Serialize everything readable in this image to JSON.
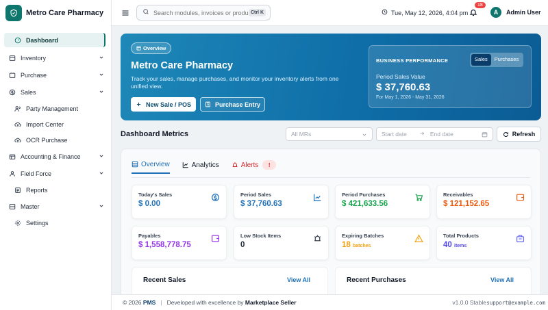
{
  "brand": {
    "name": "Metro Care Pharmacy"
  },
  "sidebar": {
    "items": [
      {
        "label": "Dashboard"
      },
      {
        "label": "Inventory"
      },
      {
        "label": "Purchase"
      },
      {
        "label": "Sales"
      },
      {
        "label": "Party Management"
      },
      {
        "label": "Import Center"
      },
      {
        "label": "OCR Purchase"
      },
      {
        "label": "Accounting & Finance"
      },
      {
        "label": "Field Force"
      },
      {
        "label": "Reports"
      },
      {
        "label": "Master"
      },
      {
        "label": "Settings"
      }
    ]
  },
  "topbar": {
    "search_placeholder": "Search modules, invoices or products...",
    "shortcut": "Ctrl K",
    "datetime": "Tue, May 12, 2026, 4:04 pm",
    "notification_count": "18",
    "avatar_initial": "A",
    "user_name": "Admin User"
  },
  "hero": {
    "chip": "Overview",
    "title": "Metro Care Pharmacy",
    "description": "Track your sales, manage purchases, and monitor your inventory alerts from one unified view.",
    "new_sale": "New Sale / POS",
    "purchase_entry": "Purchase Entry",
    "perf_title": "BUSINESS PERFORMANCE",
    "seg_sales": "Sales",
    "seg_purchases": "Purchases",
    "perf_label": "Period Sales Value",
    "perf_value": "$ 37,760.63",
    "perf_range": "For May 1, 2026 - May 31, 2026"
  },
  "metrics": {
    "title": "Dashboard Metrics",
    "mr_placeholder": "All MRs",
    "start_date": "Start date",
    "end_date": "End date",
    "refresh": "Refresh"
  },
  "tabs": {
    "overview": "Overview",
    "analytics": "Analytics",
    "alerts": "Alerts",
    "alerts_count": "!"
  },
  "stats": [
    {
      "label": "Today's Sales",
      "value": "$ 0.00",
      "color": "#1d6fb8"
    },
    {
      "label": "Period Sales",
      "value": "$ 37,760.63",
      "color": "#1d6fb8"
    },
    {
      "label": "Period Purchases",
      "value": "$ 421,633.56",
      "color": "#16a34a"
    },
    {
      "label": "Receivables",
      "value": "$ 121,152.65",
      "color": "#ea580c"
    },
    {
      "label": "Payables",
      "value": "$ 1,558,778.75",
      "color": "#9333ea"
    },
    {
      "label": "Low Stock Items",
      "value": "0",
      "color": "#1f2937"
    },
    {
      "label": "Expiring Batches",
      "value": "18",
      "unit": "batches",
      "color": "#f59e0b"
    },
    {
      "label": "Total Products",
      "value": "40",
      "unit": "items",
      "color": "#4f46e5"
    }
  ],
  "recent_sales": {
    "title": "Recent Sales",
    "view_all": "View All"
  },
  "recent_purchases": {
    "title": "Recent Purchases",
    "view_all": "View All"
  },
  "footer": {
    "copyright": "© 2026",
    "brand": "PMS",
    "developed": "Developed with excellence by",
    "seller": "Marketplace Seller",
    "version": "v1.0.0 Stable",
    "email": "support@example.com"
  }
}
